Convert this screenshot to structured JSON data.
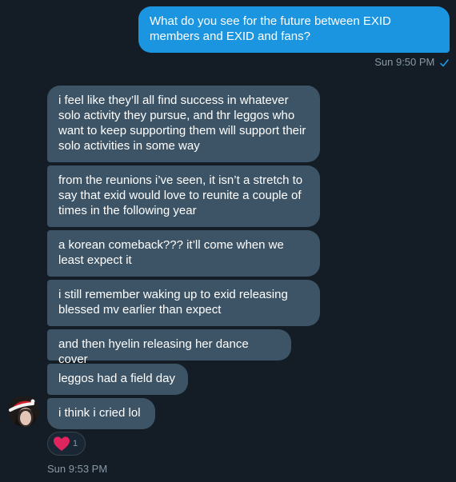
{
  "conversation": {
    "sent": {
      "text": "What do you see for the future between EXID members and EXID and fans?",
      "timestamp": "Sun 9:50 PM",
      "status_icon": "check-icon"
    },
    "received": [
      {
        "text": "i feel like they’ll all find success in whatever solo activity they pursue, and thr leggos who want to keep supporting them will support their solo activities in some way"
      },
      {
        "text": "from the reunions i’ve seen, it isn’t a stretch to say that exid would love to reunite a couple of times in the following year"
      },
      {
        "text": "a korean comeback??? it’ll come when we least expect it"
      },
      {
        "text": "i still remember waking up to exid releasing blessed mv earlier than expect"
      },
      {
        "text": "and then hyelin releasing her dance cover"
      },
      {
        "text": "leggos had a field day"
      },
      {
        "text": "i think i cried lol"
      }
    ],
    "reaction": {
      "icon": "heart-icon",
      "count": "1"
    },
    "received_timestamp": "Sun 9:53 PM",
    "avatar_icon": "avatar-santa-hat-icon"
  },
  "colors": {
    "background": "#141d26",
    "sent_bubble": "#1b95e0",
    "received_bubble": "#3d5466",
    "meta_text": "#8899a6",
    "heart": "#e0245e",
    "read_check": "#1da1f2"
  }
}
